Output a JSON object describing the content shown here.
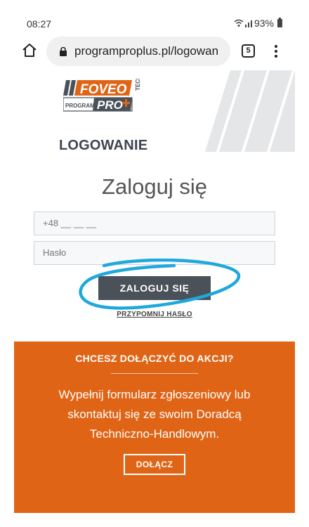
{
  "status_bar": {
    "time": "08:27",
    "battery": "93%"
  },
  "browser": {
    "url": "programproplus.pl/logowan",
    "tab_count": "5"
  },
  "header": {
    "logo_brand": "FOVEO",
    "logo_tech": "TECH",
    "logo_program": "PROGRAM",
    "logo_pro": "PRO",
    "section_label": "LOGOWANIE"
  },
  "login": {
    "title": "Zaloguj się",
    "phone_value": "+48 __ __ __",
    "password_placeholder": "Hasło",
    "submit_label": "ZALOGUJ SIĘ",
    "forgot_label": "PRZYPOMNIJ HASŁO"
  },
  "join": {
    "title": "CHCESZ DOŁĄCZYĆ DO AKCJI?",
    "text": "Wypełnij formularz zgłoszeniowy lub skontaktuj się ze swoim Doradcą Techniczno-Handlowym.",
    "button_label": "DOŁĄCZ"
  },
  "colors": {
    "accent_orange": "#e06416",
    "button_dark": "#4a5159",
    "highlight_circle": "#1fa8dc"
  }
}
